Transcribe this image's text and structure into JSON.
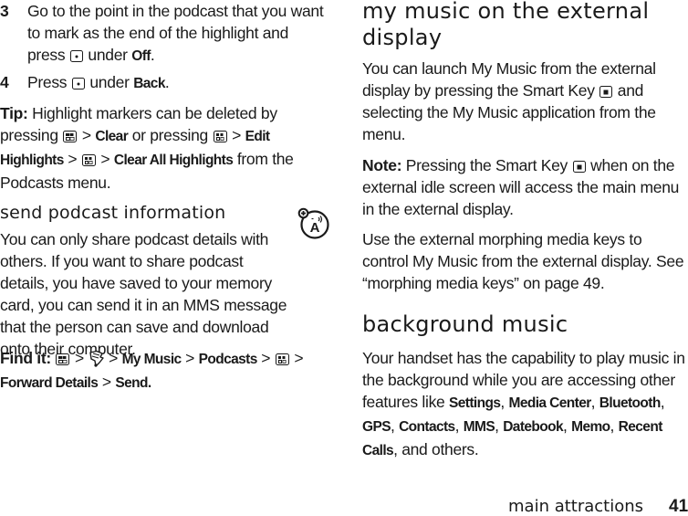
{
  "page": {
    "section_name": "main attractions",
    "page_number": "41"
  },
  "left_column": {
    "steps": [
      {
        "number": "3",
        "text_before": "Go to the point in the podcast that you want to mark as the end of the highlight and press",
        "key_icon": "center-key-icon",
        "text_mid": "under",
        "label": "Off",
        "text_end": "."
      },
      {
        "number": "4",
        "text_before": "Press",
        "key_icon": "center-key-icon",
        "text_mid": "under",
        "label": "Back",
        "text_end": "."
      }
    ],
    "tip": {
      "lead": "Tip:",
      "t1": "Highlight markers can be deleted by pressing",
      "sep": ">",
      "clear": "Clear",
      "t2": "or pressing",
      "edit_highlights": "Edit Highlights",
      "clear_all": "Clear All Highlights",
      "t3": "from the Podcasts menu."
    },
    "send_section": {
      "title": "send podcast information",
      "feature_icon": "network-feature-icon",
      "body": "You can only share podcast details with others. If you want to share podcast details, you have saved to your memory card, you can send it in an MMS message that the person can save and download onto their computer."
    },
    "find_it": {
      "lead": "Find it:",
      "sep": ">",
      "my_music": "My Music",
      "podcasts": "Podcasts",
      "forward_details": "Forward Details",
      "send": "Send",
      "end": "."
    }
  },
  "right_column": {
    "external_section": {
      "title_line1": "my music on the external",
      "title_line2": "display",
      "p1_before": "You can launch My Music from the external display by pressing the Smart Key",
      "p1_after": "and selecting the My Music application from the menu.",
      "note_lead": "Note:",
      "note_before": "Pressing the Smart Key",
      "note_after": "when on the external idle screen will access the main menu in the external display.",
      "p3": "Use the external morphing media keys to control My Music from the external display. See “morphing media keys” on page 49."
    },
    "background_section": {
      "title": "background music",
      "body_before": "Your handset has the capability to play music in the background while you are accessing other features like",
      "features": [
        "Settings",
        "Media Center",
        "Bluetooth",
        "GPS",
        "Contacts",
        "MMS",
        "Datebook",
        "Memo",
        "Recent Calls"
      ],
      "body_after": "and others."
    }
  }
}
